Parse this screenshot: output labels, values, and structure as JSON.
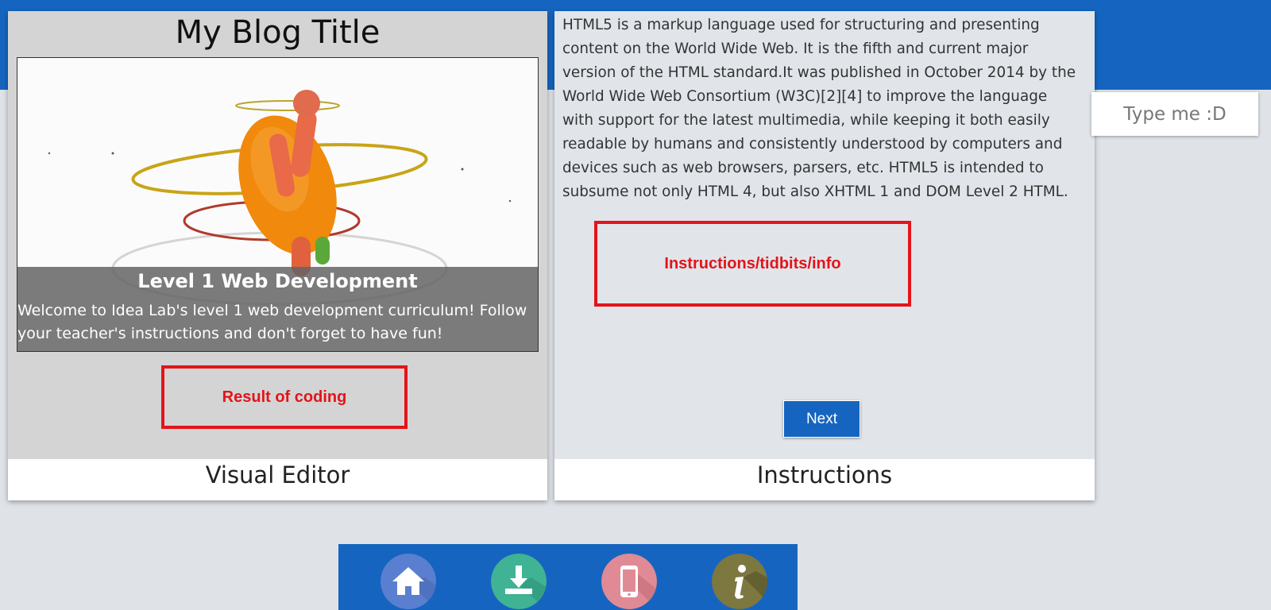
{
  "colors": {
    "accent_blue": "#1565c0",
    "highlight_red": "#e3141a",
    "home_icon_bg": "#5b7fd0",
    "download_icon_bg": "#3fb394",
    "device_icon_bg": "#e08a96",
    "info_icon_bg": "#7d7740"
  },
  "visual_editor": {
    "blog_title": "My Blog Title",
    "hero_heading": "Level 1 Web Development",
    "hero_text": "Welcome to Idea Lab's level 1 web development curriculum! Follow your teacher's instructions and don't forget to have fun!",
    "result_box_label": "Result of coding",
    "footer_label": "Visual Editor"
  },
  "instructions": {
    "body_text": "HTML5 is a markup language used for structuring and presenting content on the World Wide Web. It is the fifth and current major version of the HTML standard.It was published in October 2014 by the World Wide Web Consortium (W3C)[2][4] to improve the language with support for the latest multimedia, while keeping it both easily readable by humans and consistently understood by computers and devices such as web browsers, parsers, etc. HTML5 is intended to subsume not only HTML 4, but also XHTML 1 and DOM Level 2 HTML.",
    "info_box_label": "Instructions/tidbits/info",
    "next_button_label": "Next",
    "footer_label": "Instructions"
  },
  "side_input": {
    "placeholder": "Type me :D",
    "value": ""
  },
  "bottom_nav": {
    "items": [
      {
        "icon": "home-icon"
      },
      {
        "icon": "download-icon"
      },
      {
        "icon": "mobile-device-icon"
      },
      {
        "icon": "info-icon"
      }
    ]
  }
}
